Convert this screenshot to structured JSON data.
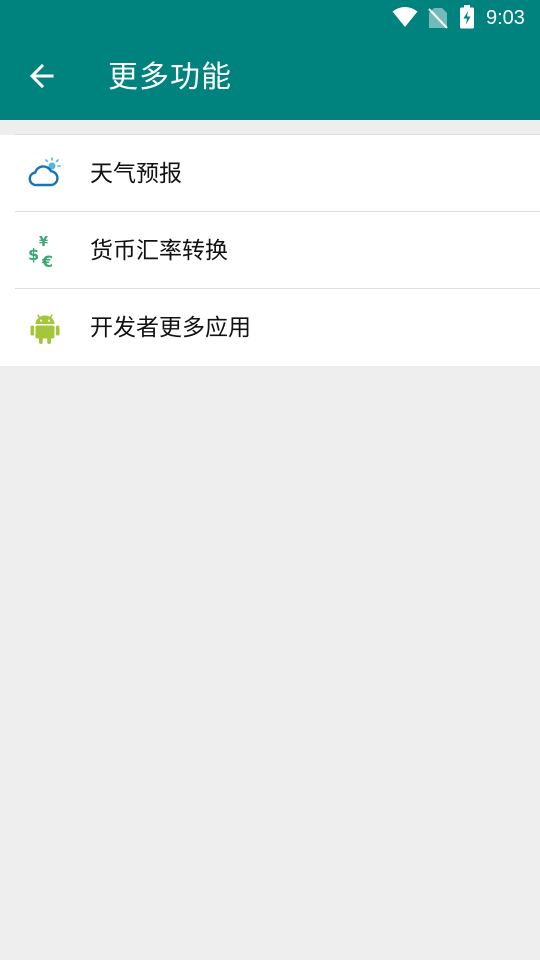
{
  "status_bar": {
    "time": "9:03",
    "icons": [
      "wifi-icon",
      "no-sim-icon",
      "battery-charging-icon"
    ]
  },
  "app_bar": {
    "title": "更多功能",
    "back_icon": "arrow-back-icon",
    "color": "#00827f"
  },
  "menu": {
    "items": [
      {
        "label": "天气预报",
        "icon": "weather-icon",
        "icon_color": "#1a73b8"
      },
      {
        "label": "货币汇率转换",
        "icon": "currency-exchange-icon",
        "icon_color": "#3aa876"
      },
      {
        "label": "开发者更多应用",
        "icon": "android-icon",
        "icon_color": "#a4c639"
      }
    ]
  }
}
